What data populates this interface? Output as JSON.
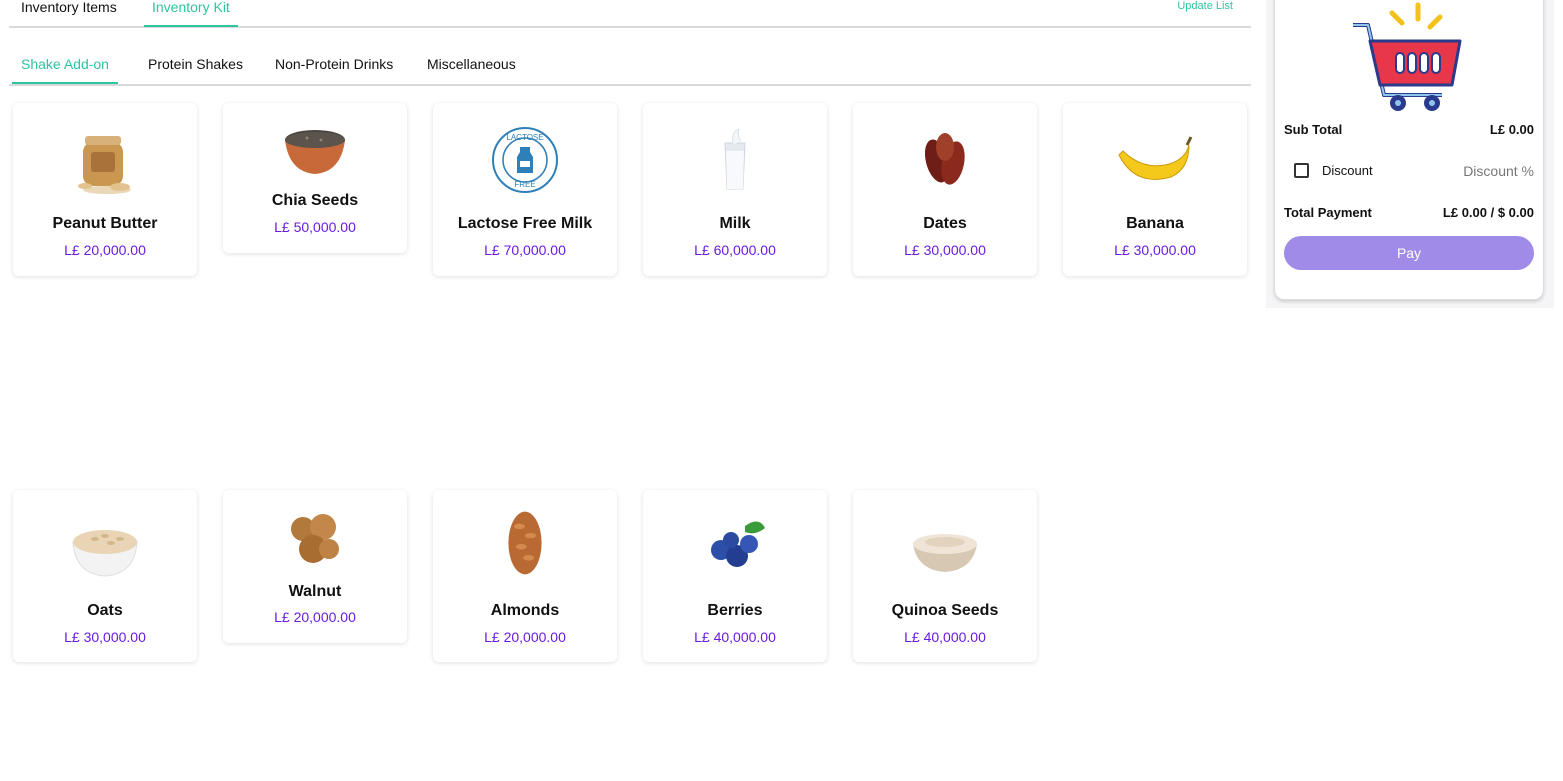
{
  "top_tabs": {
    "items": [
      "Inventory Items",
      "Inventory Kit"
    ],
    "active": "Inventory Kit",
    "update_label": "Update List"
  },
  "categories": {
    "items": [
      "Shake Add-on",
      "Protein Shakes",
      "Non-Protein Drinks",
      "Miscellaneous"
    ],
    "active": "Shake Add-on"
  },
  "products": [
    {
      "name": "Peanut Butter",
      "price": "L£ 20,000.00",
      "icon": "peanut-butter-jar-icon"
    },
    {
      "name": "Chia Seeds",
      "price": "L£ 50,000.00",
      "icon": "chia-seeds-bowl-icon"
    },
    {
      "name": "Lactose Free Milk",
      "price": "L£ 70,000.00",
      "icon": "lactose-free-badge-icon"
    },
    {
      "name": "Milk",
      "price": "L£ 60,000.00",
      "icon": "milk-glass-icon"
    },
    {
      "name": "Dates",
      "price": "L£ 30,000.00",
      "icon": "dates-icon"
    },
    {
      "name": "Banana",
      "price": "L£ 30,000.00",
      "icon": "banana-icon"
    },
    {
      "name": "Oats",
      "price": "L£ 30,000.00",
      "icon": "oats-bowl-icon"
    },
    {
      "name": "Walnut",
      "price": "L£ 20,000.00",
      "icon": "walnut-icon"
    },
    {
      "name": "Almonds",
      "price": "L£ 20,000.00",
      "icon": "almonds-icon"
    },
    {
      "name": "Berries",
      "price": "L£ 40,000.00",
      "icon": "blueberries-icon"
    },
    {
      "name": "Quinoa Seeds",
      "price": "L£ 40,000.00",
      "icon": "quinoa-bowl-icon"
    }
  ],
  "lactose_badge": {
    "top": "LACTOSE",
    "bottom": "FREE"
  },
  "cart": {
    "icon": "shopping-cart-icon",
    "subtotal_label": "Sub Total",
    "subtotal_value": "L£ 0.00",
    "discount_label": "Discount",
    "discount_placeholder": "Discount %",
    "discount_checked": false,
    "total_label": "Total Payment",
    "total_value": "L£ 0.00 / $ 0.00",
    "pay_label": "Pay"
  },
  "colors": {
    "accent": "#2ec4a0",
    "price": "#6a1be0",
    "pay_button": "#a08be8",
    "cart_red": "#e8364a",
    "cart_blue": "#2a3a8c"
  }
}
